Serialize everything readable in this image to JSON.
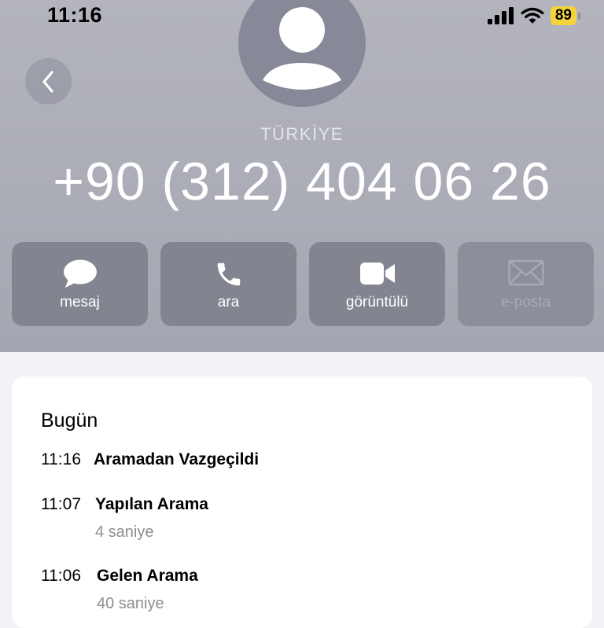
{
  "status_bar": {
    "time": "11:16",
    "battery": "89",
    "battery_color": "#f5d33b"
  },
  "icons": {
    "back": "chevron-left-icon",
    "avatar": "person-silhouette-icon",
    "message": "message-bubble-icon",
    "call": "phone-icon",
    "video": "video-camera-icon",
    "email": "envelope-icon",
    "signal": "cellular-signal-icon",
    "wifi": "wifi-icon"
  },
  "contact": {
    "country": "TÜRKİYE",
    "phone": "+90 (312) 404 06 26"
  },
  "actions": [
    {
      "label": "mesaj",
      "enabled": true
    },
    {
      "label": "ara",
      "enabled": true
    },
    {
      "label": "görüntülü",
      "enabled": true
    },
    {
      "label": "e-posta",
      "enabled": false
    }
  ],
  "recents": {
    "section": "Bugün",
    "entries": [
      {
        "time": "11:16",
        "title": "Aramadan Vazgeçildi",
        "detail": ""
      },
      {
        "time": "11:07",
        "title": "Yapılan Arama",
        "detail": "4 saniye"
      },
      {
        "time": "11:06",
        "title": "Gelen Arama",
        "detail": "40 saniye"
      }
    ]
  }
}
